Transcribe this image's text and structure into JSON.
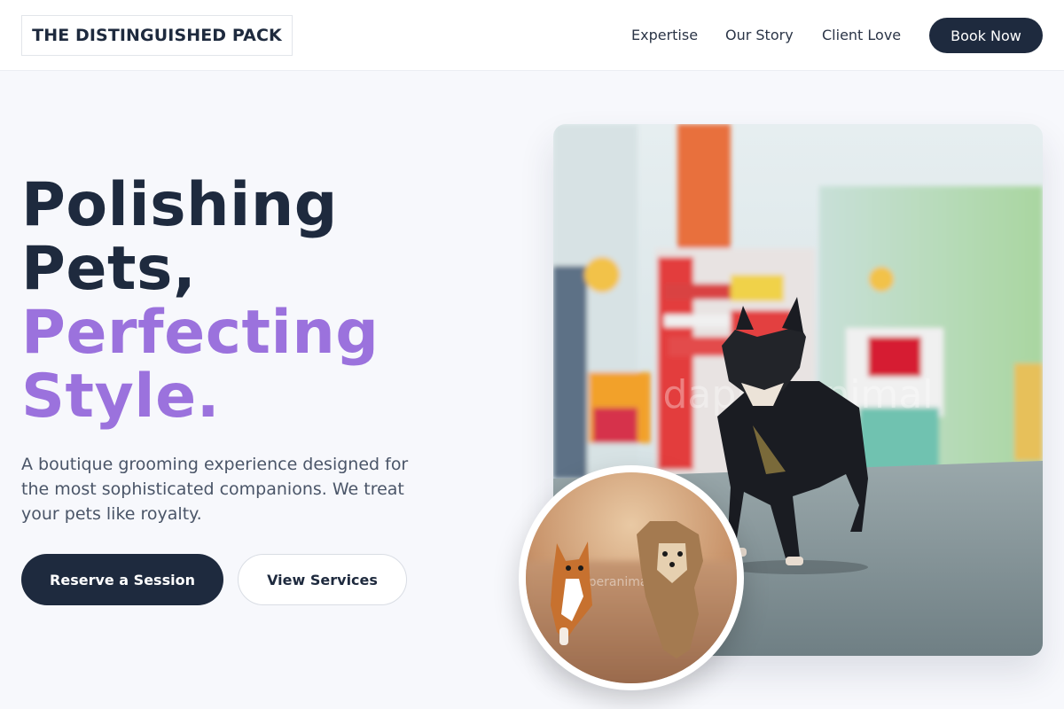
{
  "header": {
    "logo": "THE DISTINGUISHED PACK",
    "nav": [
      "Expertise",
      "Our Story",
      "Client Love"
    ],
    "cta": "Book Now"
  },
  "hero": {
    "headline_lines": [
      "Polishing",
      "Pets,",
      "Perfecting",
      "Style."
    ],
    "description": "A boutique grooming experience designed for the most sophisticated companions. We treat your pets like royalty.",
    "primary_button": "Reserve a Session",
    "secondary_button": "View Services",
    "main_image_watermark": "dapperanimal",
    "circle_image_watermark": "dapperanimal.com"
  },
  "colors": {
    "primary": "#1e2a3e",
    "accent": "#9b72dd",
    "background": "#f7f8fc"
  }
}
